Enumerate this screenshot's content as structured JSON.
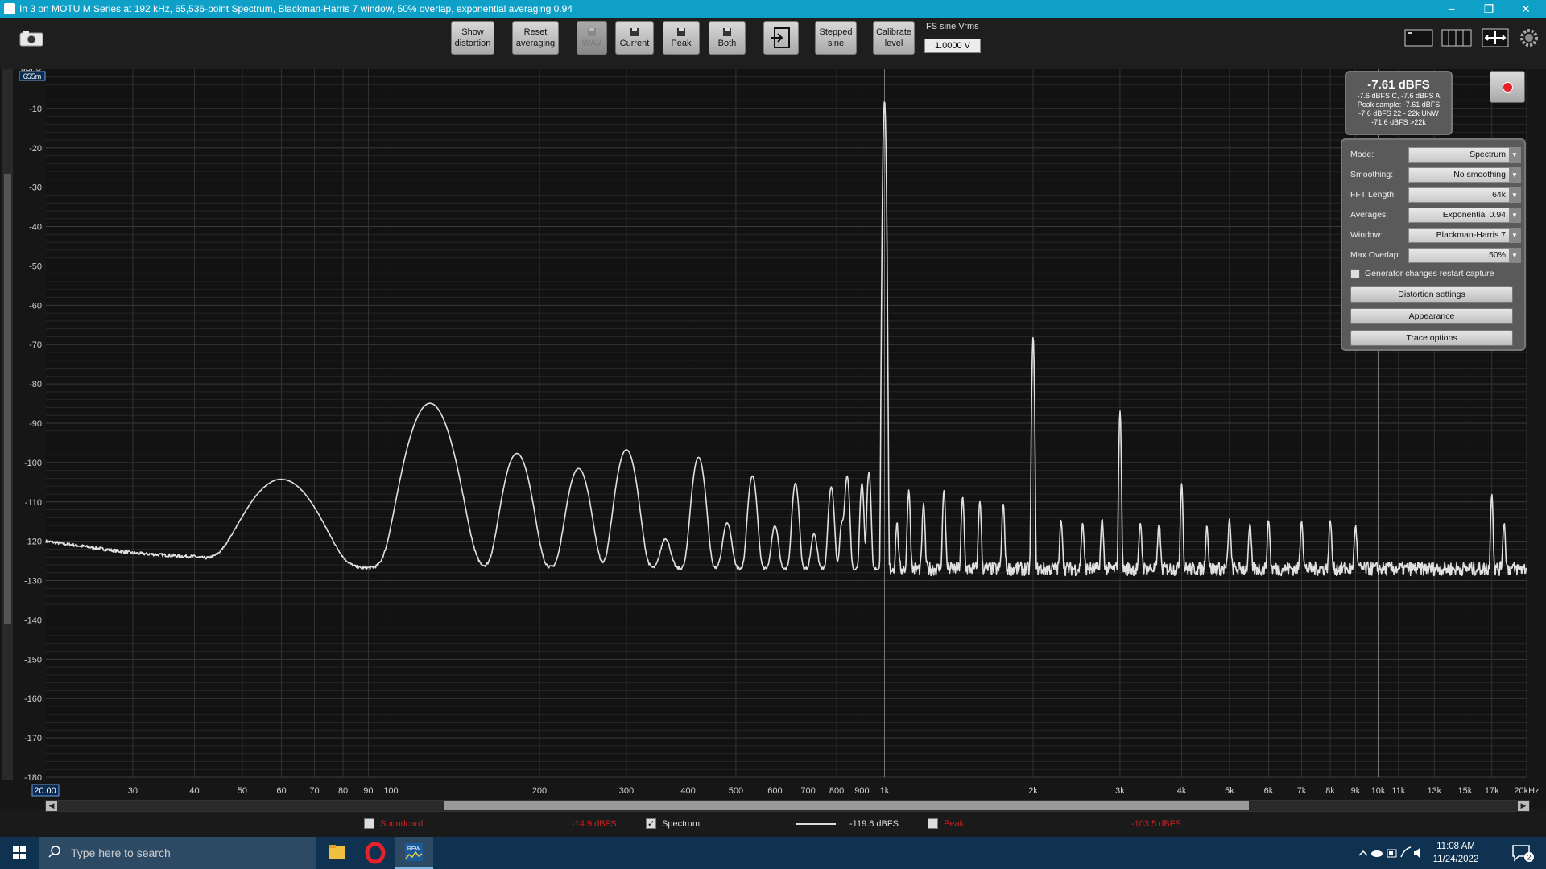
{
  "window": {
    "title": "In 3 on MOTU M Series at 192 kHz, 65,536-point Spectrum, Blackman-Harris 7 window, 50% overlap, exponential averaging 0.94",
    "minimize": "−",
    "restore": "❐",
    "close": "✕"
  },
  "toolbar": {
    "buttons": [
      {
        "line1": "Show",
        "line2": "distortion"
      },
      {
        "line1": "Reset",
        "line2": "averaging"
      },
      {
        "label": "WAV"
      },
      {
        "label": "Current"
      },
      {
        "label": "Peak"
      },
      {
        "label": "Both"
      },
      {
        "line1": "Stepped",
        "line2": "sine"
      },
      {
        "line1": "Calibrate",
        "line2": "level"
      }
    ],
    "fs_label": "FS sine Vrms",
    "fs_value": "1.0000 V"
  },
  "readout": {
    "main": "-7.61 dBFS",
    "lines": [
      "-7.6 dBFS C, -7.6 dBFS A",
      "Peak sample: -7.61 dBFS",
      "-7.6 dBFS 22 - 22k UNW",
      "-71.6 dBFS >22k"
    ]
  },
  "panel": {
    "rows": [
      {
        "label": "Mode:",
        "value": "Spectrum"
      },
      {
        "label": "Smoothing:",
        "value": "No  smoothing"
      },
      {
        "label": "FFT Length:",
        "value": "64k"
      },
      {
        "label": "Averages:",
        "value": "Exponential 0.94"
      },
      {
        "label": "Window:",
        "value": "Blackman-Harris 7"
      },
      {
        "label": "Max Overlap:",
        "value": "50%"
      }
    ],
    "generator_option": "Generator changes restart capture",
    "buttons": [
      "Distortion settings",
      "Appearance",
      "Trace options"
    ]
  },
  "legend": {
    "items": [
      {
        "name": "Soundcard",
        "value": "-14.9 dBFS",
        "checked": false,
        "color": "#cc2020"
      },
      {
        "name": "Spectrum",
        "value": "-119.6 dBFS",
        "checked": true,
        "color": "#dddddd"
      },
      {
        "name": "Peak",
        "value": "-103.5 dBFS",
        "checked": false,
        "color": "#cc2020"
      }
    ]
  },
  "chart_data": {
    "type": "line",
    "title": "",
    "xlabel": "",
    "ylabel": "dBFS",
    "y_cursor_value": "655m",
    "x_start_label": "20.00",
    "xlim": [
      20,
      20000
    ],
    "ylim": [
      -180,
      0
    ],
    "xscale": "log",
    "grid": true,
    "y_ticks": [
      -10,
      -20,
      -30,
      -40,
      -50,
      -60,
      -70,
      -80,
      -90,
      -100,
      -110,
      -120,
      -130,
      -140,
      -150,
      -160,
      -170,
      -180
    ],
    "x_ticks": [
      {
        "v": 30,
        "t": "30"
      },
      {
        "v": 40,
        "t": "40"
      },
      {
        "v": 50,
        "t": "50"
      },
      {
        "v": 60,
        "t": "60"
      },
      {
        "v": 70,
        "t": "70"
      },
      {
        "v": 80,
        "t": "80"
      },
      {
        "v": 90,
        "t": "90"
      },
      {
        "v": 100,
        "t": "100"
      },
      {
        "v": 200,
        "t": "200"
      },
      {
        "v": 300,
        "t": "300"
      },
      {
        "v": 400,
        "t": "400"
      },
      {
        "v": 500,
        "t": "500"
      },
      {
        "v": 600,
        "t": "600"
      },
      {
        "v": 700,
        "t": "700"
      },
      {
        "v": 800,
        "t": "800"
      },
      {
        "v": 900,
        "t": "900"
      },
      {
        "v": 1000,
        "t": "1k"
      },
      {
        "v": 2000,
        "t": "2k"
      },
      {
        "v": 3000,
        "t": "3k"
      },
      {
        "v": 4000,
        "t": "4k"
      },
      {
        "v": 5000,
        "t": "5k"
      },
      {
        "v": 6000,
        "t": "6k"
      },
      {
        "v": 7000,
        "t": "7k"
      },
      {
        "v": 8000,
        "t": "8k"
      },
      {
        "v": 9000,
        "t": "9k"
      },
      {
        "v": 10000,
        "t": "10k"
      },
      {
        "v": 11000,
        "t": "11k"
      },
      {
        "v": 13000,
        "t": "13k"
      },
      {
        "v": 15000,
        "t": "15k"
      },
      {
        "v": 17000,
        "t": "17k"
      },
      {
        "v": 20000,
        "t": "20kHz"
      }
    ],
    "series": [
      {
        "color": "#e0e0e0",
        "baseline": [
          [
            20,
            -120
          ],
          [
            30,
            -123
          ],
          [
            40,
            -124
          ],
          [
            45,
            -126
          ],
          [
            50,
            -126
          ],
          [
            55,
            -126
          ],
          [
            60,
            -126
          ],
          [
            70,
            -127
          ],
          [
            80,
            -128
          ],
          [
            90,
            -127
          ],
          [
            100,
            -127
          ],
          [
            1000,
            -127
          ],
          [
            20000,
            -127
          ]
        ],
        "peaks": [
          {
            "f": 60,
            "db": -105,
            "w": 0.07
          },
          {
            "f": 120,
            "db": -85,
            "w": 0.04
          },
          {
            "f": 180,
            "db": -98,
            "w": 0.026
          },
          {
            "f": 240,
            "db": -102,
            "w": 0.022
          },
          {
            "f": 300,
            "db": -97,
            "w": 0.02
          },
          {
            "f": 360,
            "db": -124,
            "w": 0.012
          },
          {
            "f": 420,
            "db": -99,
            "w": 0.013
          },
          {
            "f": 480,
            "db": -118,
            "w": 0.01
          },
          {
            "f": 540,
            "db": -104,
            "w": 0.009
          },
          {
            "f": 600,
            "db": -119,
            "w": 0.008
          },
          {
            "f": 660,
            "db": -106,
            "w": 0.007
          },
          {
            "f": 720,
            "db": -122,
            "w": 0.007
          },
          {
            "f": 780,
            "db": -107,
            "w": 0.006
          },
          {
            "f": 820,
            "db": -118,
            "w": 0.005
          },
          {
            "f": 840,
            "db": -104,
            "w": 0.005
          },
          {
            "f": 900,
            "db": -106,
            "w": 0.004
          },
          {
            "f": 930,
            "db": -103,
            "w": 0.004
          },
          {
            "f": 1000,
            "db": -8,
            "w": 0.0025
          },
          {
            "f": 1060,
            "db": -118,
            "w": 0.003
          },
          {
            "f": 1120,
            "db": -108,
            "w": 0.003
          },
          {
            "f": 1200,
            "db": -112,
            "w": 0.003
          },
          {
            "f": 1320,
            "db": -108,
            "w": 0.003
          },
          {
            "f": 1440,
            "db": -110,
            "w": 0.003
          },
          {
            "f": 1560,
            "db": -111,
            "w": 0.003
          },
          {
            "f": 1740,
            "db": -112,
            "w": 0.003
          },
          {
            "f": 2000,
            "db": -68,
            "w": 0.0022
          },
          {
            "f": 2280,
            "db": -117,
            "w": 0.003
          },
          {
            "f": 2520,
            "db": -118,
            "w": 0.003
          },
          {
            "f": 2760,
            "db": -117,
            "w": 0.003
          },
          {
            "f": 3000,
            "db": -87,
            "w": 0.0022
          },
          {
            "f": 3300,
            "db": -118,
            "w": 0.003
          },
          {
            "f": 3600,
            "db": -118,
            "w": 0.003
          },
          {
            "f": 4000,
            "db": -106,
            "w": 0.0025
          },
          {
            "f": 4500,
            "db": -119,
            "w": 0.003
          },
          {
            "f": 5000,
            "db": -117,
            "w": 0.003
          },
          {
            "f": 5500,
            "db": -119,
            "w": 0.003
          },
          {
            "f": 6000,
            "db": -117,
            "w": 0.003
          },
          {
            "f": 7000,
            "db": -117,
            "w": 0.003
          },
          {
            "f": 8000,
            "db": -117,
            "w": 0.003
          },
          {
            "f": 9000,
            "db": -119,
            "w": 0.003
          },
          {
            "f": 17000,
            "db": -109,
            "w": 0.0025
          },
          {
            "f": 18000,
            "db": -118,
            "w": 0.003
          }
        ]
      }
    ]
  },
  "taskbar": {
    "search_placeholder": "Type here to search",
    "time": "11:08 AM",
    "date": "11/24/2022",
    "notifications": "2",
    "rew_label": "REW"
  }
}
